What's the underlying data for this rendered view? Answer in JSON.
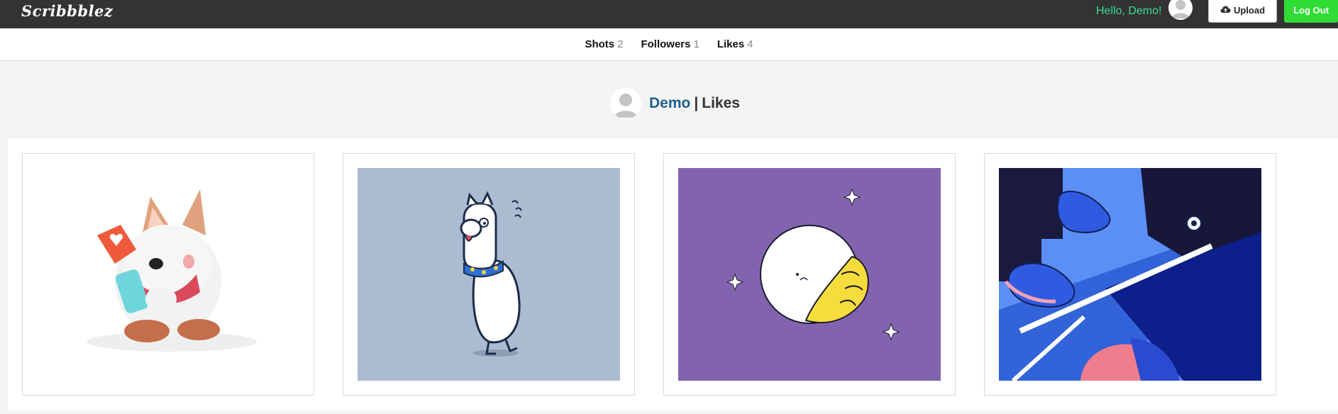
{
  "app": {
    "logo": "Scribbblez"
  },
  "topbar": {
    "greeting": "Hello, Demo!",
    "upload_label": "Upload",
    "logout_label": "Log Out",
    "upload_icon": "cloud-upload-icon",
    "avatar_icon": "user-avatar-icon"
  },
  "tabs": [
    {
      "label": "Shots",
      "count": "2"
    },
    {
      "label": "Followers",
      "count": "1"
    },
    {
      "label": "Likes",
      "count": "4"
    }
  ],
  "profile": {
    "name": "Demo",
    "separator": "|",
    "section": "Likes"
  },
  "shots": [
    {
      "subject": "corgi-with-phone"
    },
    {
      "subject": "llama-walking"
    },
    {
      "subject": "hand-holding-moon"
    },
    {
      "subject": "sneakers-skateboard"
    }
  ],
  "colors": {
    "topbar": "#333333",
    "greeting": "#3ddb9c",
    "logout": "#2fdc35",
    "profile_name": "#1e5f8e",
    "band": "#f4f4f4"
  }
}
